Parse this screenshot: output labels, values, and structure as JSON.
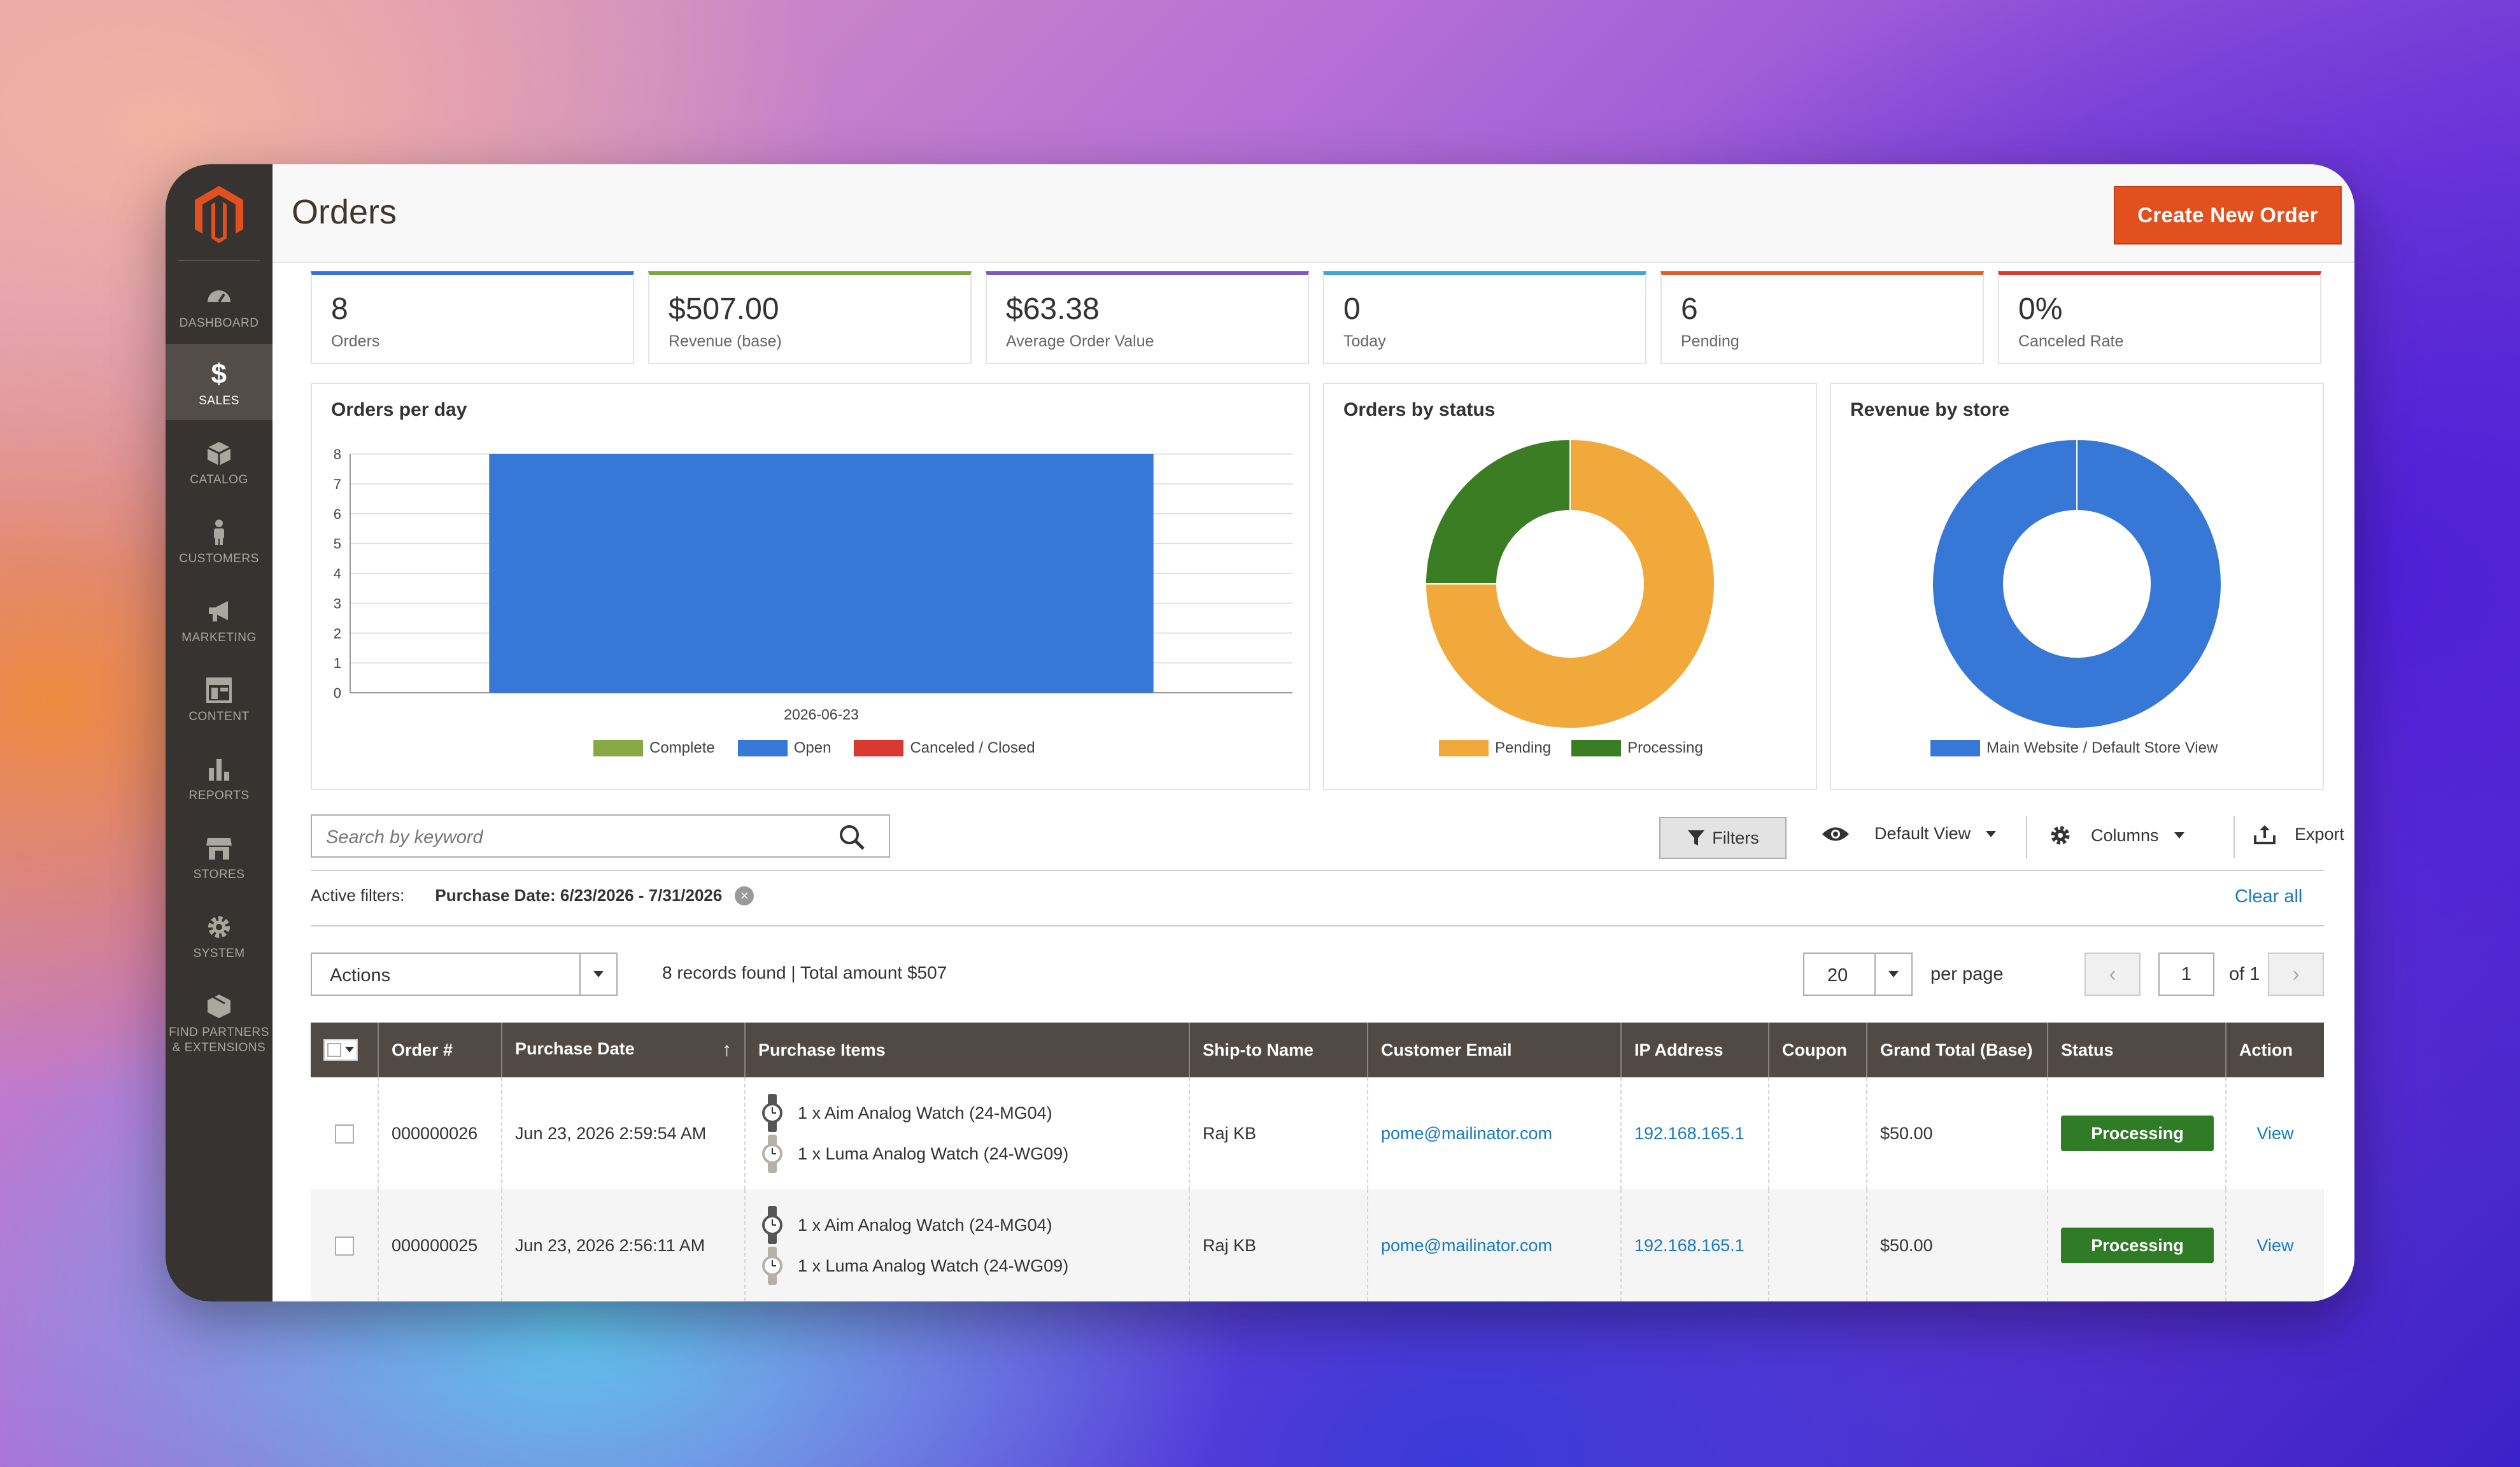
{
  "sidebar": {
    "items": [
      {
        "label": "DASHBOARD",
        "icon": "dashboard-icon"
      },
      {
        "label": "SALES",
        "icon": "dollar-icon",
        "active": true
      },
      {
        "label": "CATALOG",
        "icon": "cube-icon"
      },
      {
        "label": "CUSTOMERS",
        "icon": "person-icon"
      },
      {
        "label": "MARKETING",
        "icon": "megaphone-icon"
      },
      {
        "label": "CONTENT",
        "icon": "layout-icon"
      },
      {
        "label": "REPORTS",
        "icon": "bar-chart-icon"
      },
      {
        "label": "STORES",
        "icon": "store-icon"
      },
      {
        "label": "SYSTEM",
        "icon": "gear-icon"
      },
      {
        "label": "FIND PARTNERS",
        "label2": "& EXTENSIONS",
        "icon": "box-icon"
      }
    ]
  },
  "header": {
    "title": "Orders",
    "create_button": "Create New Order"
  },
  "tiles": [
    {
      "value": "8",
      "label": "Orders",
      "color": "#3474d4"
    },
    {
      "value": "$507.00",
      "label": "Revenue (base)",
      "color": "#7ba83c"
    },
    {
      "value": "$63.38",
      "label": "Average Order Value",
      "color": "#7e57c2"
    },
    {
      "value": "0",
      "label": "Today",
      "color": "#3ea6d8"
    },
    {
      "value": "6",
      "label": "Pending",
      "color": "#e25b2a"
    },
    {
      "value": "0%",
      "label": "Canceled Rate",
      "color": "#d93a30"
    }
  ],
  "chart_data": [
    {
      "type": "bar",
      "title": "Orders per day",
      "categories": [
        "2026-06-23"
      ],
      "yticks": [
        "0",
        "1",
        "2",
        "3",
        "4",
        "5",
        "6",
        "7",
        "8"
      ],
      "ylim": [
        0,
        8
      ],
      "grid": true,
      "series": [
        {
          "name": "Complete",
          "values": [
            0
          ],
          "color": "#88a844"
        },
        {
          "name": "Open",
          "values": [
            8
          ],
          "color": "#3778d6"
        },
        {
          "name": "Canceled / Closed",
          "values": [
            0
          ],
          "color": "#d83a32"
        }
      ],
      "legend": "bottom"
    },
    {
      "type": "pie",
      "title": "Orders by status",
      "donut": true,
      "slices": [
        {
          "label": "Pending",
          "value": 6,
          "color": "#f2a93b"
        },
        {
          "label": "Processing",
          "value": 2,
          "color": "#3a7d22"
        }
      ],
      "legend": "bottom"
    },
    {
      "type": "pie",
      "title": "Revenue by store",
      "donut": true,
      "slices": [
        {
          "label": "Main Website / Default Store View",
          "value": 507,
          "color": "#3778d6"
        }
      ],
      "legend": "bottom"
    }
  ],
  "toolbar": {
    "search_placeholder": "Search by keyword",
    "filters": "Filters",
    "view": "Default View",
    "columns": "Columns",
    "export": "Export"
  },
  "active_filters": {
    "label": "Active filters:",
    "value": "Purchase Date: 6/23/2026 - 7/31/2026",
    "clear_all": "Clear all"
  },
  "grid_controls": {
    "actions": "Actions",
    "records": "8 records found | Total amount $507",
    "per_page_value": "20",
    "per_page_label": "per page",
    "page": "1",
    "of_pages": "of 1"
  },
  "table": {
    "headers": [
      "Order #",
      "Purchase Date",
      "Purchase Items",
      "Ship-to Name",
      "Customer Email",
      "IP Address",
      "Coupon",
      "Grand Total (Base)",
      "Status",
      "Action"
    ],
    "sort_arrow": "↑",
    "rows": [
      {
        "order": "000000026",
        "date": "Jun 23, 2026 2:59:54 AM",
        "items": [
          "1 x Aim Analog Watch (24-MG04)",
          "1 x Luma Analog Watch (24-WG09)"
        ],
        "ship_to": "Raj KB",
        "email": "pome@mailinator.com",
        "ip": "192.168.165.1",
        "coupon": "",
        "total": "$50.00",
        "status": "Processing",
        "action": "View"
      },
      {
        "order": "000000025",
        "date": "Jun 23, 2026 2:56:11 AM",
        "items": [
          "1 x Aim Analog Watch (24-MG04)",
          "1 x Luma Analog Watch (24-WG09)"
        ],
        "ship_to": "Raj KB",
        "email": "pome@mailinator.com",
        "ip": "192.168.165.1",
        "coupon": "",
        "total": "$50.00",
        "status": "Processing",
        "action": "View"
      }
    ]
  }
}
